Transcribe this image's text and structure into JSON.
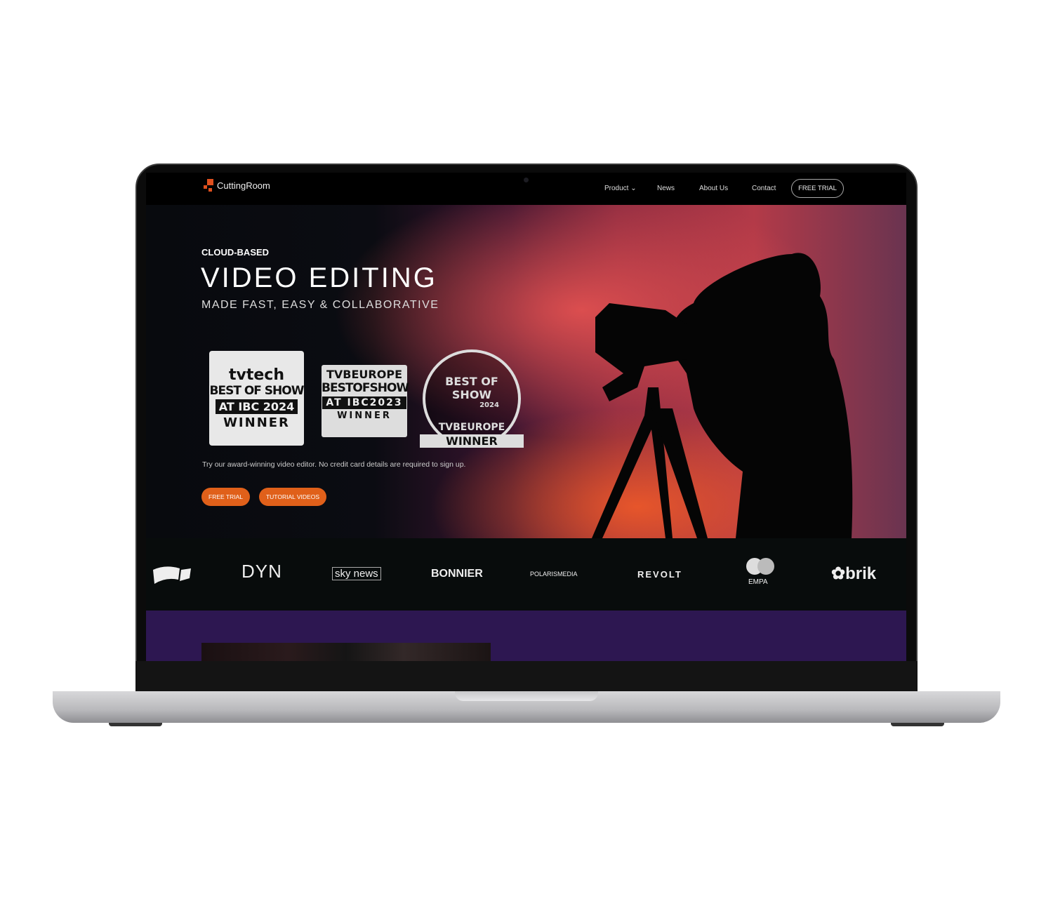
{
  "nav": {
    "brand": "CuttingRoom",
    "items": [
      "Product",
      "News",
      "About Us",
      "Contact"
    ],
    "cta": "FREE TRIAL"
  },
  "hero": {
    "kicker": "CLOUD-BASED",
    "title": "VIDEO EDITING",
    "subtitle": "MADE FAST, EASY & COLLABORATIVE",
    "badges": [
      {
        "l1": "tvtech",
        "l2": "BEST OF SHOW",
        "l3": "AT IBC 2024",
        "l4": "WINNER"
      },
      {
        "l1": "TVBEUROPE",
        "l2": "BESTOFSHOW",
        "l3": "AT IBC2023",
        "l4": "WINNER"
      },
      {
        "l1": "BEST OF SHOW",
        "l2": "2024",
        "l3": "TVBEUROPE",
        "l4": "WINNER"
      }
    ],
    "tagline": "Try our award-winning video editor. No credit card details are required to sign up.",
    "buttons": [
      "FREE TRIAL",
      "TUTORIAL VIDEOS"
    ],
    "accent": "#e0601a"
  },
  "clients": [
    "DYN",
    "sky news",
    "BONNIER",
    "POLARISMEDIA",
    "REVOLT",
    "EMPA",
    "brik"
  ],
  "colors": {
    "purple": "#2d1751"
  }
}
